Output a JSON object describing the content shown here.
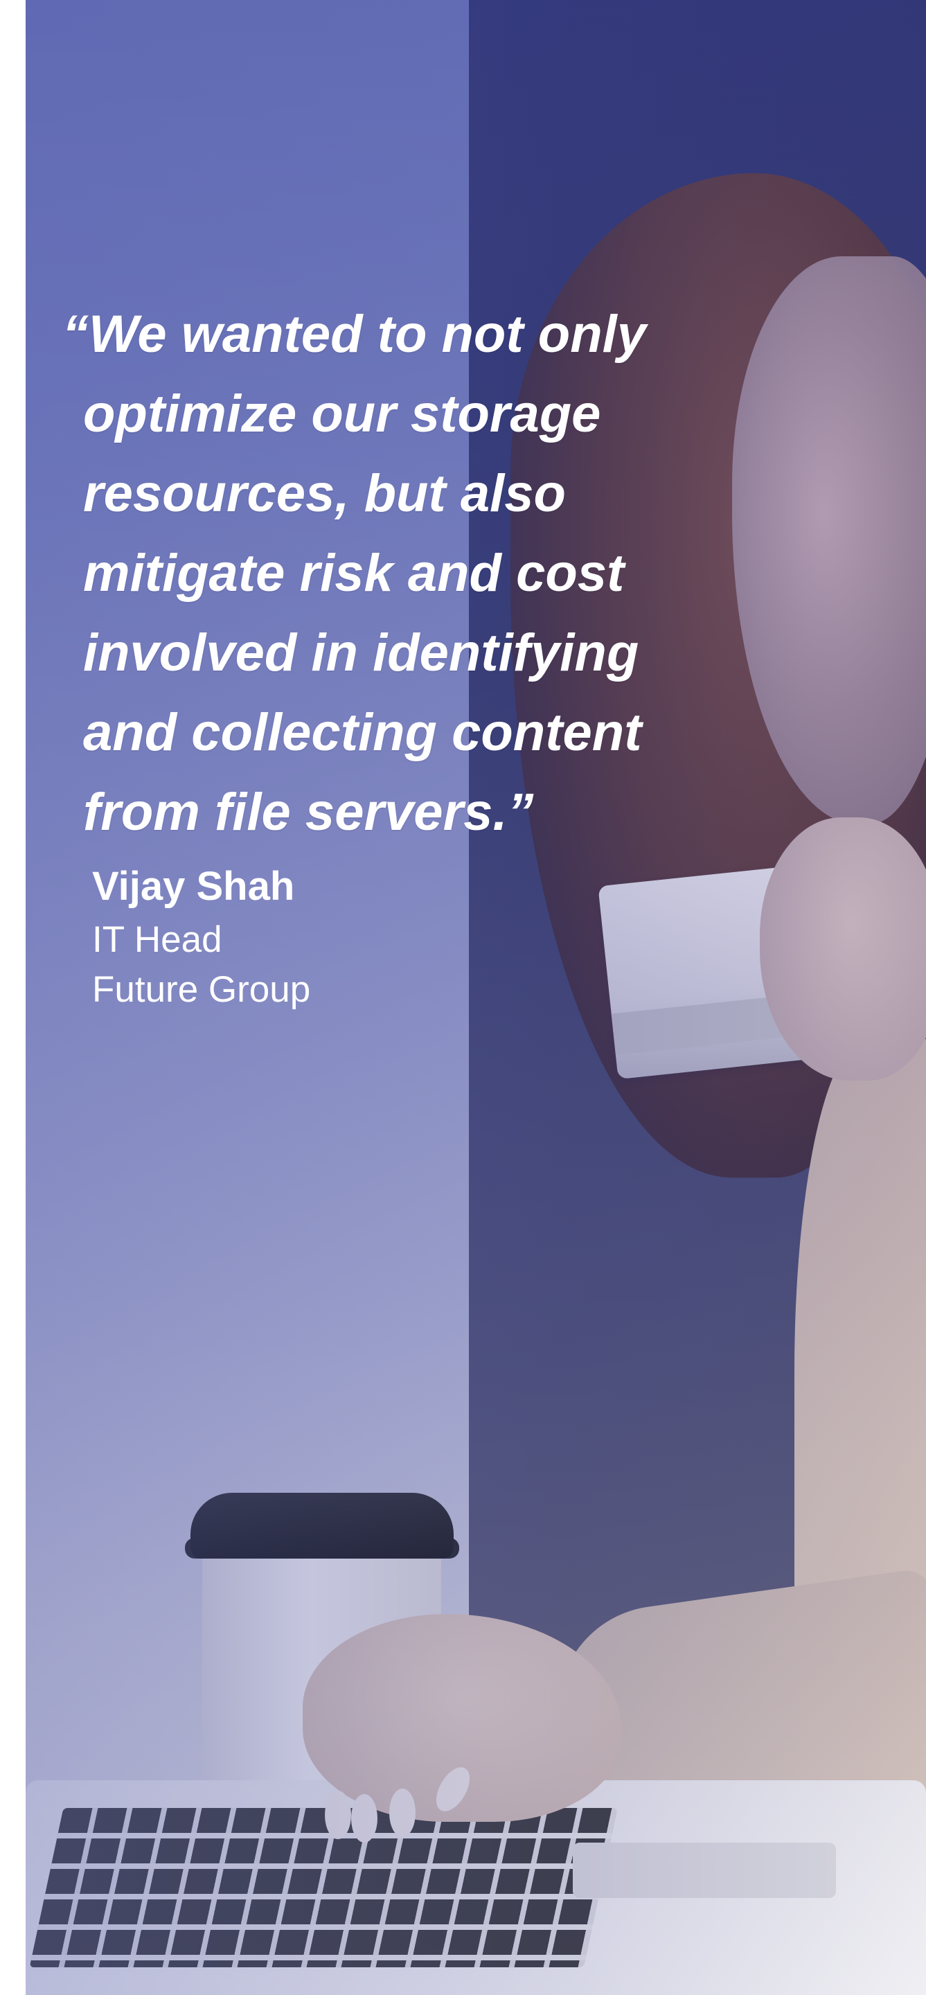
{
  "testimonial": {
    "quote_lines": [
      "“We wanted to not only",
      "optimize our storage",
      "resources, but also",
      "mitigate risk and cost",
      "involved in identifying",
      "and collecting content",
      "from file servers.”"
    ],
    "author_name": "Vijay Shah",
    "author_title": "IT Head",
    "author_company": "Future Group"
  },
  "colors": {
    "overlay": "#5660a8",
    "text": "#ffffff"
  }
}
